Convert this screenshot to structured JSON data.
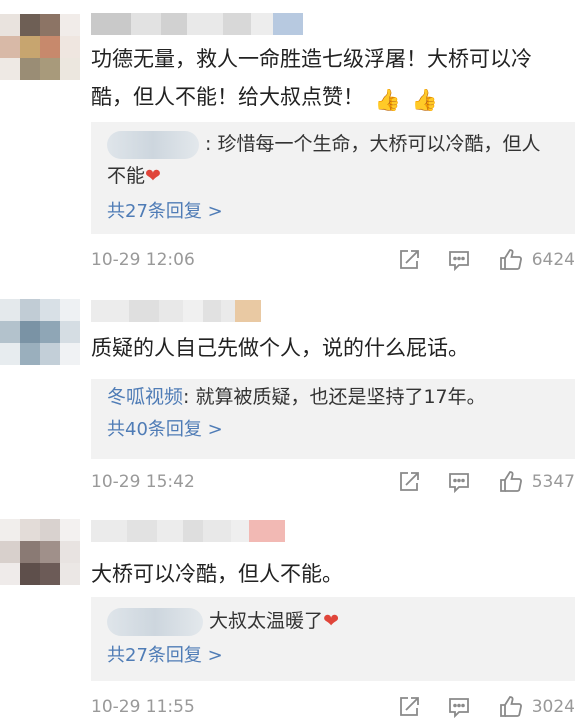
{
  "comments": [
    {
      "body_line1": "功德无量，救人一命胜造七级浮屠！大桥可以冷",
      "body_line2": "酷，但人不能！给大叔点赞！",
      "emoji": "👍",
      "reply_text_line1": ": 珍惜每一个生命，大桥可以冷酷，但人",
      "reply_text_line2": "不能",
      "reply_emoji": "❤",
      "reply_count": "共27条回复 >",
      "time": "10-29 12:06",
      "likes": "6424"
    },
    {
      "body_line1": "质疑的人自己先做个人，说的什么屁话。",
      "reply_author": "冬呱视频",
      "reply_text_line1": ": 就算被质疑，也还是坚持了17年。",
      "reply_count": "共40条回复 >",
      "time": "10-29 15:42",
      "likes": "5347"
    },
    {
      "body_line1": "大桥可以冷酷，但人不能。",
      "reply_text_line1": "大叔太温暖了",
      "reply_emoji": "❤",
      "reply_count": "共27条回复 >",
      "time": "10-29 11:55",
      "likes": "3024"
    }
  ],
  "icons": [
    "share-icon",
    "comment-icon",
    "like-icon"
  ],
  "colors": {
    "link": "#4f7cb6",
    "meta": "#999999",
    "reply_bg": "#f2f2f2",
    "heart": "#e0453a"
  }
}
